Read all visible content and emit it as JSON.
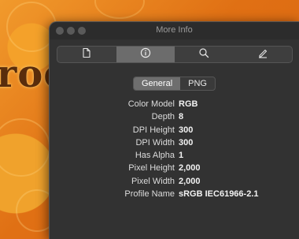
{
  "background": {
    "word": "roc"
  },
  "window": {
    "title": "More Info",
    "toolbar": {
      "tools": [
        {
          "icon": "document-icon",
          "active": false
        },
        {
          "icon": "info-icon",
          "active": true
        },
        {
          "icon": "magnifier-icon",
          "active": false
        },
        {
          "icon": "pencil-icon",
          "active": false
        }
      ]
    },
    "tabs": [
      {
        "label": "General",
        "selected": true
      },
      {
        "label": "PNG",
        "selected": false
      }
    ],
    "properties": [
      {
        "key": "Color Model",
        "value": "RGB"
      },
      {
        "key": "Depth",
        "value": "8"
      },
      {
        "key": "DPI Height",
        "value": "300"
      },
      {
        "key": "DPI Width",
        "value": "300"
      },
      {
        "key": "Has Alpha",
        "value": "1"
      },
      {
        "key": "Pixel Height",
        "value": "2,000"
      },
      {
        "key": "Pixel Width",
        "value": "2,000"
      },
      {
        "key": "Profile Name",
        "value": "sRGB IEC61966-2.1"
      }
    ]
  }
}
